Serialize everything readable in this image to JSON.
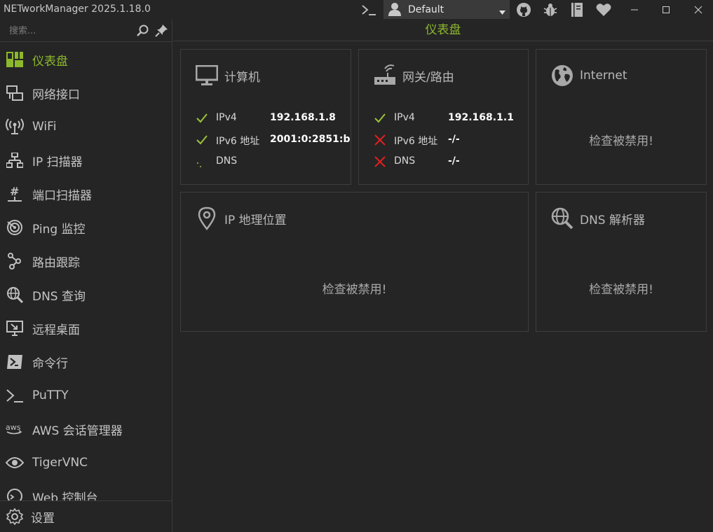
{
  "app": {
    "title": "NETworkManager 2025.1.18.0"
  },
  "profile": {
    "name": "Default"
  },
  "search": {
    "placeholder": "搜索..."
  },
  "nav": {
    "items": [
      {
        "label": "仪表盘"
      },
      {
        "label": "网络接口"
      },
      {
        "label": "WiFi"
      },
      {
        "label": "IP 扫描器"
      },
      {
        "label": "端口扫描器"
      },
      {
        "label": "Ping 监控"
      },
      {
        "label": "路由跟踪"
      },
      {
        "label": "DNS 查询"
      },
      {
        "label": "远程桌面"
      },
      {
        "label": "命令行"
      },
      {
        "label": "PuTTY"
      },
      {
        "label": "AWS 会话管理器"
      },
      {
        "label": "TigerVNC"
      },
      {
        "label": "Web 控制台"
      }
    ],
    "settings_label": "设置"
  },
  "main": {
    "title": "仪表盘",
    "computer": {
      "title": "计算机",
      "rows": [
        {
          "key": "IPv4",
          "value": "192.168.1.8",
          "status": "ok"
        },
        {
          "key": "IPv6 地址",
          "value": "2001:0:2851:b",
          "status": "ok"
        },
        {
          "key": "DNS",
          "value": "",
          "status": "loading"
        }
      ]
    },
    "gateway": {
      "title": "网关/路由",
      "rows": [
        {
          "key": "IPv4",
          "value": "192.168.1.1",
          "status": "ok"
        },
        {
          "key": "IPv6 地址",
          "value": "-/-",
          "status": "fail"
        },
        {
          "key": "DNS",
          "value": "-/-",
          "status": "fail"
        }
      ]
    },
    "internet": {
      "title": "Internet",
      "message": "检查被禁用!"
    },
    "geo": {
      "title": "IP 地理位置",
      "message": "检查被禁用!"
    },
    "dns": {
      "title": "DNS 解析器",
      "message": "检查被禁用!"
    }
  },
  "colors": {
    "accent": "#8db82c",
    "ok": "#9cc43a",
    "fail": "#e02020",
    "background": "#252525",
    "border": "#3d3d3d"
  }
}
